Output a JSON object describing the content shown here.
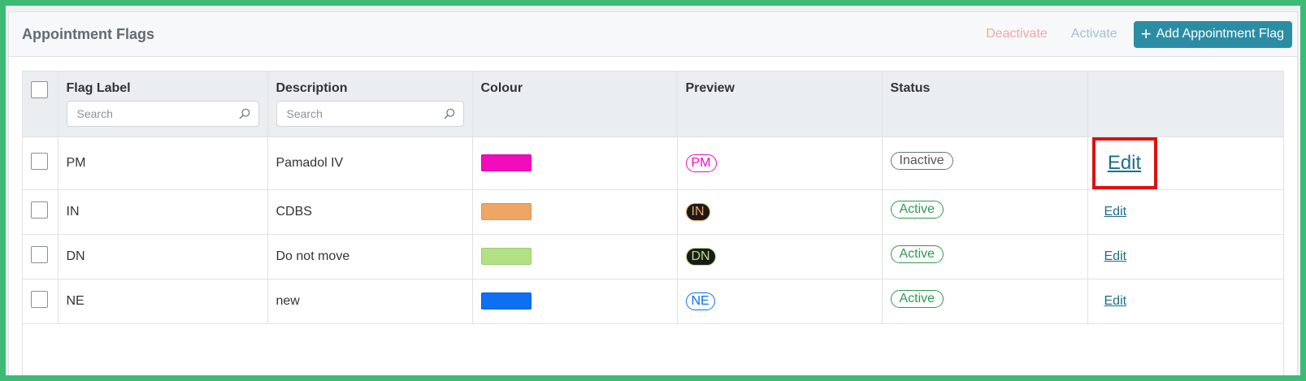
{
  "header": {
    "title": "Appointment Flags",
    "deactivate_label": "Deactivate",
    "activate_label": "Activate",
    "add_label": "Add Appointment Flag",
    "add_icon": "plus-icon"
  },
  "table": {
    "columns": {
      "flag_label": "Flag Label",
      "description": "Description",
      "colour": "Colour",
      "preview": "Preview",
      "status": "Status",
      "actions": ""
    },
    "search_placeholder_label": "Search",
    "search_placeholder_description": "Search",
    "rows": [
      {
        "label": "PM",
        "description": "Pamadol IV",
        "colour": "#f20cbe",
        "preview_text": "PM",
        "preview_bg": "#ffffff",
        "preview_fg": "#f20cbe",
        "preview_border": "#f20cbe",
        "status": "Inactive",
        "action": "Edit"
      },
      {
        "label": "IN",
        "description": "CDBS",
        "colour": "#efa564",
        "preview_text": "IN",
        "preview_bg": "#1a1a1a",
        "preview_fg": "#efa564",
        "preview_border": "#efa564",
        "status": "Active",
        "action": "Edit"
      },
      {
        "label": "DN",
        "description": "Do not move",
        "colour": "#b1e184",
        "preview_text": "DN",
        "preview_bg": "#1a1a1a",
        "preview_fg": "#b1e184",
        "preview_border": "#b1e184",
        "status": "Active",
        "action": "Edit"
      },
      {
        "label": "NE",
        "description": "new",
        "colour": "#0d6ff2",
        "preview_text": "NE",
        "preview_bg": "#ffffff",
        "preview_fg": "#0d6ff2",
        "preview_border": "#0d6ff2",
        "status": "Active",
        "action": "Edit"
      }
    ]
  },
  "colors": {
    "accent": "#2b8da3",
    "highlight": "#dd1111",
    "active": "#2e9a4f",
    "inactive": "#6c757d",
    "frame": "#3dba76"
  }
}
